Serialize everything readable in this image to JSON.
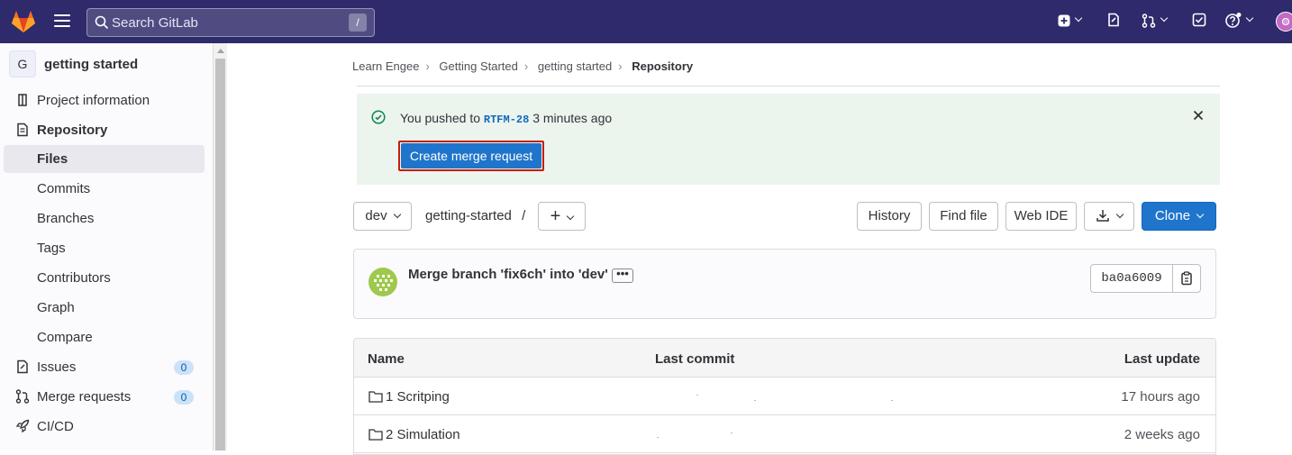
{
  "topbar": {
    "search_placeholder": "Search GitLab",
    "search_shortcut": "/"
  },
  "sidebar": {
    "project_initial": "G",
    "project_name": "getting started",
    "items": [
      {
        "label": "Project information"
      },
      {
        "label": "Repository"
      },
      {
        "label": "Files"
      },
      {
        "label": "Commits"
      },
      {
        "label": "Branches"
      },
      {
        "label": "Tags"
      },
      {
        "label": "Contributors"
      },
      {
        "label": "Graph"
      },
      {
        "label": "Compare"
      },
      {
        "label": "Issues",
        "count": "0"
      },
      {
        "label": "Merge requests",
        "count": "0"
      },
      {
        "label": "CI/CD"
      }
    ]
  },
  "breadcrumb": [
    "Learn Engee",
    "Getting Started",
    "getting started",
    "Repository"
  ],
  "alert": {
    "text_before": "You pushed to ",
    "branch": "RTFM-28",
    "text_after": " 3 minutes ago",
    "button": "Create merge request"
  },
  "toolbar": {
    "branch": "dev",
    "path": "getting-started",
    "path_sep": "/",
    "add": "+",
    "history": "History",
    "find_file": "Find file",
    "web_ide": "Web IDE",
    "clone": "Clone"
  },
  "commit": {
    "title": "Merge branch 'fix6ch' into 'dev'",
    "ellipsis": "•••",
    "sha": "ba0a6009"
  },
  "table": {
    "headers": [
      "Name",
      "Last commit",
      "Last update"
    ],
    "rows": [
      {
        "name": "1 Scritping",
        "updated": "17 hours ago"
      },
      {
        "name": "2 Simulation",
        "updated": "2 weeks ago"
      }
    ]
  },
  "colors": {
    "topbar": "#2f2a6b",
    "primary": "#1f75cb",
    "alert_bg": "#ecf4ee",
    "highlight_border": "#c91c00"
  }
}
